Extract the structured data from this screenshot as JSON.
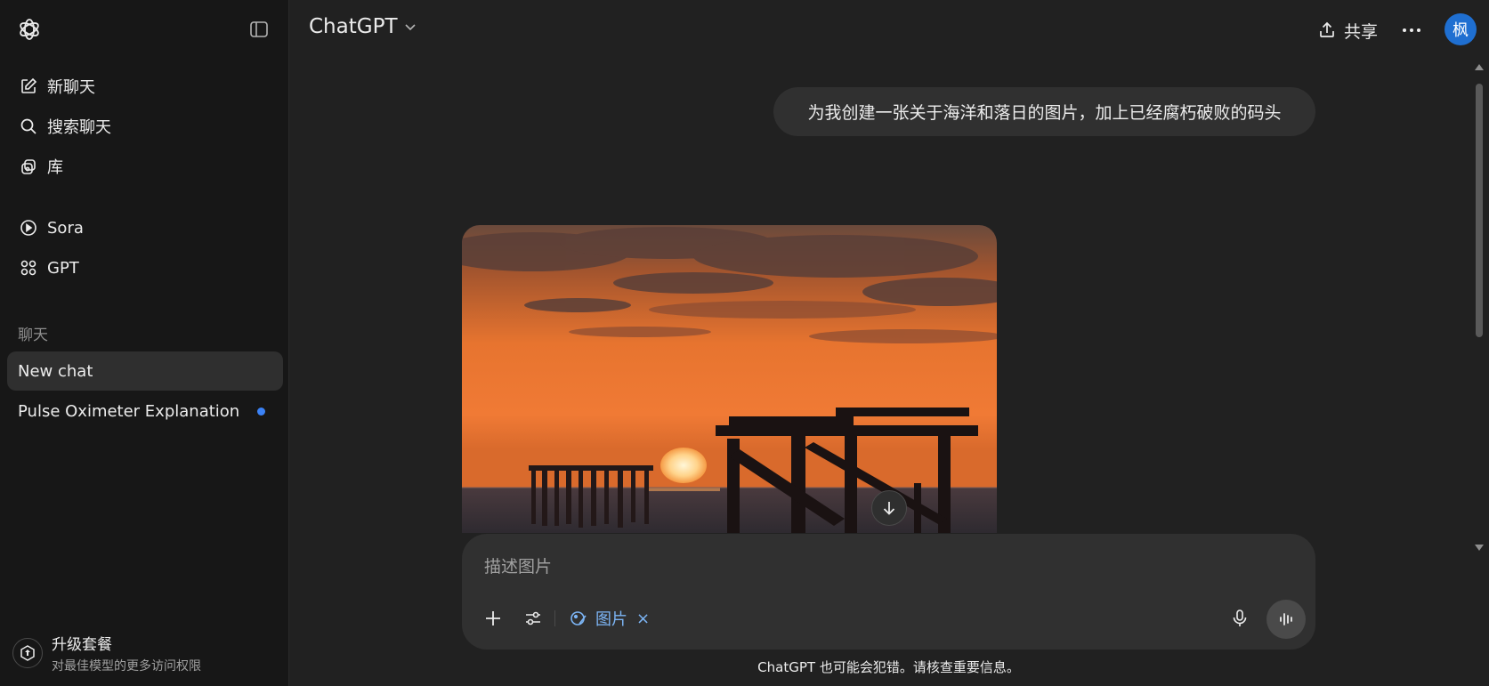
{
  "sidebar": {
    "nav": [
      {
        "label": "新聊天",
        "icon": "edit-icon"
      },
      {
        "label": "搜索聊天",
        "icon": "search-icon"
      },
      {
        "label": "库",
        "icon": "library-icon"
      },
      {
        "label": "Sora",
        "icon": "play-circle-icon"
      },
      {
        "label": "GPT",
        "icon": "grid-icon"
      }
    ],
    "section_label": "聊天",
    "chats": [
      {
        "label": "New chat",
        "active": true
      },
      {
        "label": "Pulse Oximeter Explanation",
        "unread": true
      }
    ],
    "upgrade": {
      "title": "升级套餐",
      "subtitle": "对最佳模型的更多访问权限"
    }
  },
  "header": {
    "title": "ChatGPT",
    "share_label": "共享",
    "avatar_text": "枫"
  },
  "conversation": {
    "user_message": "为我创建一张关于海洋和落日的图片，加上已经腐朽破败的码头"
  },
  "composer": {
    "placeholder": "描述图片",
    "tool_pill": "图片",
    "tool_pill_close": "×"
  },
  "disclaimer": "ChatGPT 也可能会犯错。请核查重要信息。",
  "colors": {
    "background": "#212121",
    "sidebar": "#171717",
    "accent": "#7cb5f5",
    "avatar": "#1f6fd1",
    "unread_dot": "#3b82f6"
  }
}
